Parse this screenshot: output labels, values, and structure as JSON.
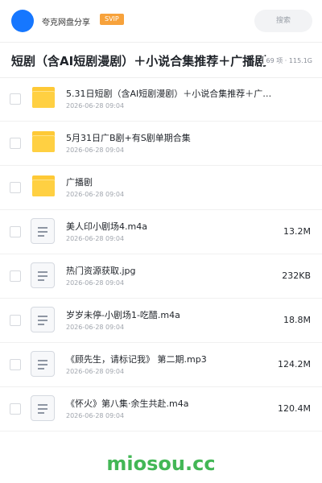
{
  "header": {
    "user_name": "夸克网盘分享",
    "badge": "SVIP",
    "search_placeholder": "搜索"
  },
  "folder": {
    "title": "短剧（含AI短剧漫剧）＋小说合集推荐＋广播剧",
    "meta": "69 项 · 115.1G"
  },
  "files": [
    {
      "type": "folder",
      "name": "5.31日短剧（含AI短剧漫剧）＋小说合集推荐＋广…",
      "date": "2026-06-28 09:04",
      "size": ""
    },
    {
      "type": "folder",
      "name": "5月31日广B剧+有S剧单期合集",
      "date": "2026-06-28 09:04",
      "size": ""
    },
    {
      "type": "folder",
      "name": "广播剧",
      "date": "2026-06-28 09:04",
      "size": ""
    },
    {
      "type": "file",
      "name": "美人印小剧场4.m4a",
      "date": "2026-06-28 09:04",
      "size": "13.2M"
    },
    {
      "type": "file",
      "name": "热门资源获取.jpg",
      "date": "2026-06-28 09:04",
      "size": "232KB"
    },
    {
      "type": "file",
      "name": "岁岁未停-小剧场1-吃醋.m4a",
      "date": "2026-06-28 09:04",
      "size": "18.8M"
    },
    {
      "type": "file",
      "name": "《顾先生，请标记我》 第二期.mp3",
      "date": "2026-06-28 09:04",
      "size": "124.2M"
    },
    {
      "type": "file",
      "name": "《怀火》第八集·余生共赴.m4a",
      "date": "2026-06-28 09:04",
      "size": "120.4M"
    }
  ],
  "watermark": "miosou.cc",
  "colors": {
    "accent": "#1677ff",
    "folder": "#ffd042",
    "svip": "#f7a23b",
    "watermark": "#43b756"
  }
}
